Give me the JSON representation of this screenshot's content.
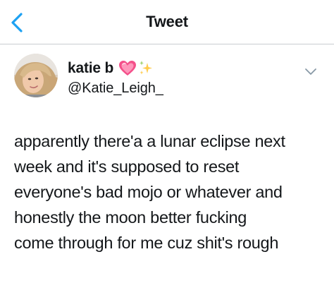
{
  "nav": {
    "title": "Tweet"
  },
  "author": {
    "display_name": "katie b",
    "handle": "@Katie_Leigh_",
    "emoji_icons": [
      "heart-icon",
      "sparkles-icon"
    ]
  },
  "tweet": {
    "lines": [
      "apparently there'a a lunar eclipse next",
      "week and it's supposed to reset",
      "everyone's bad mojo or whatever and",
      "honestly the moon better fucking",
      "come through for me cuz shit's rough"
    ]
  },
  "colors": {
    "text": "#14171a",
    "back_arrow": "#1da1f2",
    "heart": "#e0245e",
    "sparkles": "#ffcc4d",
    "divider": "#c8ccd0",
    "chevron": "#8899a6"
  }
}
